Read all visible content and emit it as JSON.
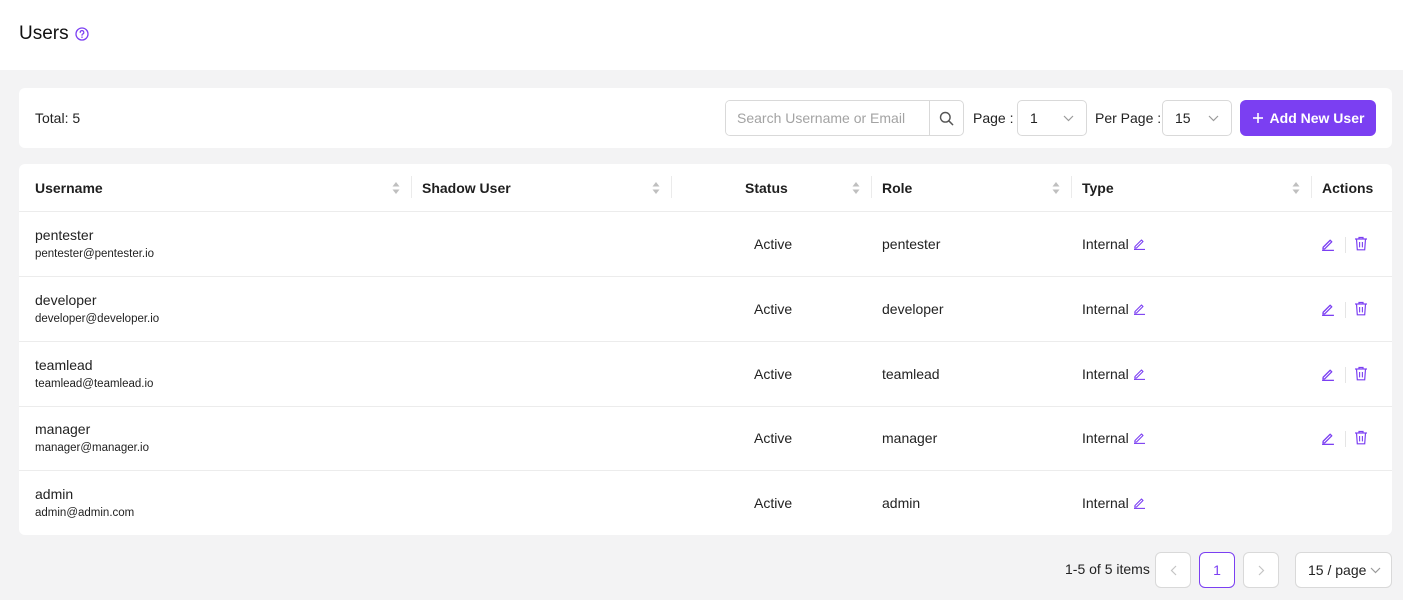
{
  "page": {
    "title": "Users"
  },
  "toolbar": {
    "total_label": "Total: 5",
    "search_placeholder": "Search Username or Email",
    "page_label": "Page :",
    "page_value": "1",
    "per_page_label": "Per Page :",
    "per_page_value": "15",
    "add_button_label": "Add New User"
  },
  "table": {
    "columns": {
      "username": "Username",
      "shadow_user": "Shadow User",
      "status": "Status",
      "role": "Role",
      "type": "Type",
      "actions": "Actions"
    },
    "rows": [
      {
        "username": "pentester",
        "email": "pentester@pentester.io",
        "shadow_user": "",
        "status": "Active",
        "role": "pentester",
        "type": "Internal",
        "can_edit": true,
        "can_delete": true
      },
      {
        "username": "developer",
        "email": "developer@developer.io",
        "shadow_user": "",
        "status": "Active",
        "role": "developer",
        "type": "Internal",
        "can_edit": true,
        "can_delete": true
      },
      {
        "username": "teamlead",
        "email": "teamlead@teamlead.io",
        "shadow_user": "",
        "status": "Active",
        "role": "teamlead",
        "type": "Internal",
        "can_edit": true,
        "can_delete": true
      },
      {
        "username": "manager",
        "email": "manager@manager.io",
        "shadow_user": "",
        "status": "Active",
        "role": "manager",
        "type": "Internal",
        "can_edit": true,
        "can_delete": true
      },
      {
        "username": "admin",
        "email": "admin@admin.com",
        "shadow_user": "",
        "status": "Active",
        "role": "admin",
        "type": "Internal",
        "can_edit": false,
        "can_delete": false
      }
    ]
  },
  "pagination": {
    "info": "1-5 of 5 items",
    "current_page": "1",
    "page_size": "15 / page"
  },
  "colors": {
    "accent": "#7b3ff2",
    "background": "#f3f3f4",
    "icon_gray": "#8c8c8c"
  },
  "icons": [
    "help-icon",
    "search-icon",
    "chevron-down-icon",
    "plus-icon",
    "sort-icon",
    "pencil-icon",
    "trash-icon",
    "chevron-left-icon",
    "chevron-right-icon"
  ]
}
